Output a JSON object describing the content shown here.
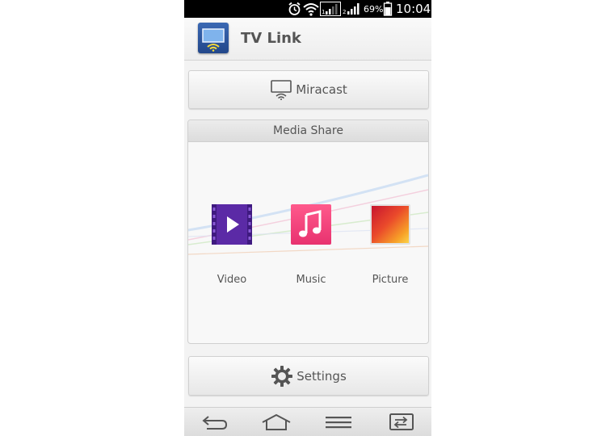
{
  "status_bar": {
    "battery_percent": "69%",
    "time": "10:04",
    "icons": [
      "alarm-icon",
      "wifi-icon",
      "signal-1-icon",
      "signal-2-icon",
      "battery-icon"
    ]
  },
  "app": {
    "title": "TV Link",
    "icon": "tv-cast-icon"
  },
  "miracast": {
    "label": "Miracast",
    "icon": "cast-screen-icon"
  },
  "media_share": {
    "title": "Media Share",
    "items": [
      {
        "label": "Video",
        "icon": "video-play-icon",
        "color": "#5b2aa6"
      },
      {
        "label": "Music",
        "icon": "music-note-icon",
        "color": "#e8326f"
      },
      {
        "label": "Picture",
        "icon": "picture-icon",
        "color": "#ea4a2b"
      }
    ]
  },
  "settings": {
    "label": "Settings",
    "icon": "gear-icon"
  },
  "nav_bar": {
    "icons": [
      "back-icon",
      "home-icon",
      "menu-icon",
      "switch-icon"
    ]
  }
}
